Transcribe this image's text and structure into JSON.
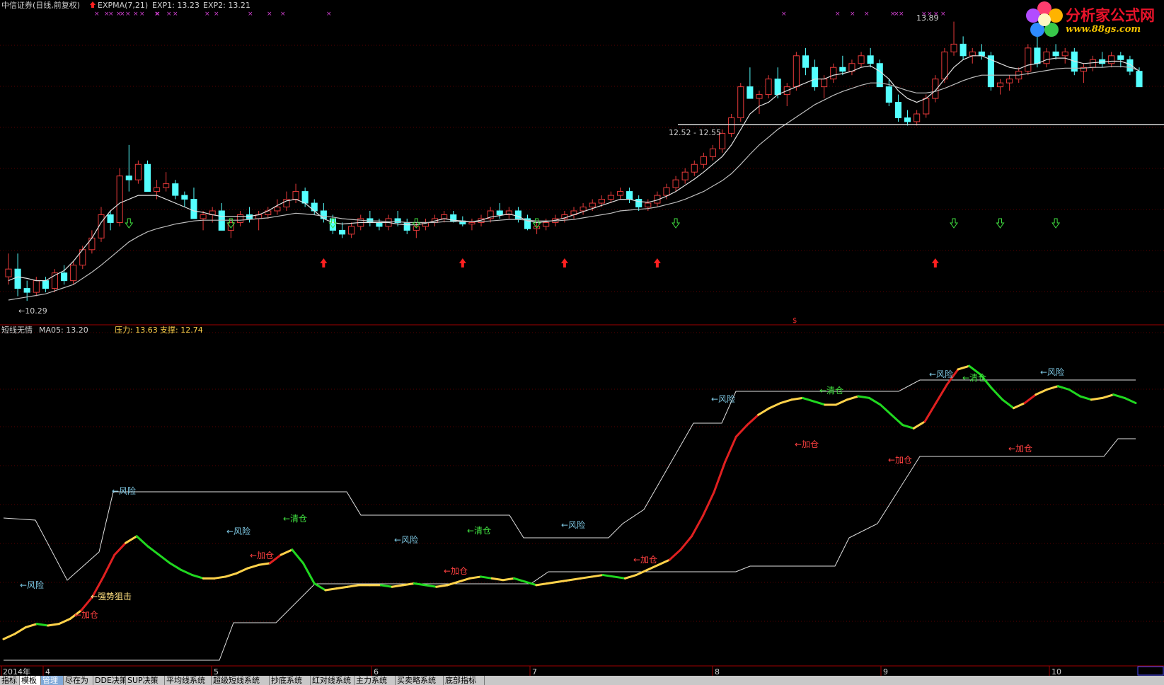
{
  "header": {
    "stock_title": "中信证券(日线,前复权)",
    "indicator_name": "EXPMA(7,21)",
    "exp1": "EXP1: 13.23",
    "exp2": "EXP2: 13.21"
  },
  "price_panel": {
    "high_label": "13.89",
    "low_label": "←10.29",
    "range_label": "12.52 - 12.55",
    "dollar_marker": "$"
  },
  "indicator_panel": {
    "name": "短线无情",
    "ma5": "MA05: 13.20",
    "pressure": "压力: 13.63",
    "support": "支撑: 12.74",
    "annotations": [
      {
        "text": "←风险",
        "color": "#7ec8e3"
      },
      {
        "text": "←加仓",
        "color": "#ff4040"
      },
      {
        "text": "←强势狙击",
        "color": "#ffe080"
      },
      {
        "text": "←风险",
        "color": "#7ec8e3"
      },
      {
        "text": "←风险",
        "color": "#7ec8e3"
      },
      {
        "text": "←加仓",
        "color": "#ff4040"
      },
      {
        "text": "←清仓",
        "color": "#40e040"
      },
      {
        "text": "←风险",
        "color": "#7ec8e3"
      },
      {
        "text": "←加仓",
        "color": "#ff4040"
      },
      {
        "text": "←清仓",
        "color": "#40e040"
      },
      {
        "text": "←风险",
        "color": "#7ec8e3"
      },
      {
        "text": "←加仓",
        "color": "#ff4040"
      },
      {
        "text": "←风险",
        "color": "#7ec8e3"
      },
      {
        "text": "←加仓",
        "color": "#ff4040"
      },
      {
        "text": "←清仓",
        "color": "#40e040"
      },
      {
        "text": "←加仓",
        "color": "#ff4040"
      },
      {
        "text": "←风险",
        "color": "#7ec8e3"
      },
      {
        "text": "←清仓",
        "color": "#40e040"
      },
      {
        "text": "←加仓",
        "color": "#ff4040"
      },
      {
        "text": "←风险",
        "color": "#7ec8e3"
      }
    ]
  },
  "time_axis": [
    "2014年",
    "4",
    "5",
    "6",
    "7",
    "8",
    "9",
    "10"
  ],
  "tabs": [
    "指标",
    "模板",
    "管理",
    "尽在为",
    "DDE决策",
    "SUP决策",
    "平均线系统",
    "超级短线系统",
    "抄底系统",
    "红对线系统",
    "主力系统",
    "买卖略系统",
    "底部指标"
  ],
  "logo": {
    "name": "分析家公式网",
    "url": "www.88gs.com"
  },
  "colors": {
    "up_candle": "#e83a3a",
    "down_candle": "#54ffff",
    "grid": "#5a0000",
    "seg_red": "#e02020",
    "seg_yellow": "#ffd24a",
    "seg_green": "#20d820"
  },
  "chart_data": [
    {
      "type": "candlestick",
      "title": "",
      "ylim": [
        10.2,
        13.95
      ],
      "ohlc": [
        [
          10.6,
          10.9,
          10.5,
          10.7
        ],
        [
          10.7,
          10.9,
          10.35,
          10.45
        ],
        [
          10.45,
          10.55,
          10.29,
          10.4
        ],
        [
          10.4,
          10.6,
          10.35,
          10.55
        ],
        [
          10.55,
          10.6,
          10.4,
          10.45
        ],
        [
          10.45,
          10.7,
          10.4,
          10.65
        ],
        [
          10.65,
          10.75,
          10.5,
          10.55
        ],
        [
          10.55,
          10.8,
          10.5,
          10.75
        ],
        [
          10.75,
          11.0,
          10.7,
          10.95
        ],
        [
          10.95,
          11.2,
          10.9,
          11.1
        ],
        [
          11.1,
          11.5,
          11.05,
          11.4
        ],
        [
          11.4,
          11.45,
          11.2,
          11.3
        ],
        [
          11.3,
          12.0,
          11.25,
          11.9
        ],
        [
          11.9,
          12.3,
          11.7,
          11.85
        ],
        [
          11.85,
          12.1,
          11.8,
          12.05
        ],
        [
          12.05,
          12.1,
          11.8,
          11.7
        ],
        [
          11.7,
          11.85,
          11.6,
          11.75
        ],
        [
          11.75,
          11.95,
          11.7,
          11.8
        ],
        [
          11.8,
          11.85,
          11.6,
          11.65
        ],
        [
          11.65,
          11.7,
          11.5,
          11.6
        ],
        [
          11.6,
          11.75,
          11.45,
          11.35
        ],
        [
          11.35,
          11.45,
          11.2,
          11.4
        ],
        [
          11.4,
          11.5,
          11.3,
          11.45
        ],
        [
          11.45,
          11.55,
          11.2,
          11.2
        ],
        [
          11.2,
          11.35,
          11.1,
          11.3
        ],
        [
          11.3,
          11.45,
          11.25,
          11.4
        ],
        [
          11.4,
          11.5,
          11.3,
          11.35
        ],
        [
          11.35,
          11.45,
          11.2,
          11.4
        ],
        [
          11.4,
          11.5,
          11.35,
          11.45
        ],
        [
          11.45,
          11.6,
          11.4,
          11.5
        ],
        [
          11.5,
          11.7,
          11.45,
          11.6
        ],
        [
          11.6,
          11.8,
          11.55,
          11.7
        ],
        [
          11.7,
          11.75,
          11.5,
          11.55
        ],
        [
          11.55,
          11.6,
          11.4,
          11.45
        ],
        [
          11.45,
          11.55,
          11.3,
          11.35
        ],
        [
          11.35,
          11.4,
          11.15,
          11.2
        ],
        [
          11.2,
          11.3,
          11.1,
          11.15
        ],
        [
          11.15,
          11.3,
          11.1,
          11.25
        ],
        [
          11.25,
          11.4,
          11.2,
          11.35
        ],
        [
          11.35,
          11.45,
          11.25,
          11.3
        ],
        [
          11.3,
          11.35,
          11.2,
          11.25
        ],
        [
          11.25,
          11.4,
          11.2,
          11.35
        ],
        [
          11.35,
          11.45,
          11.25,
          11.3
        ],
        [
          11.3,
          11.35,
          11.15,
          11.2
        ],
        [
          11.2,
          11.3,
          11.1,
          11.25
        ],
        [
          11.25,
          11.35,
          11.2,
          11.3
        ],
        [
          11.3,
          11.4,
          11.25,
          11.35
        ],
        [
          11.35,
          11.45,
          11.3,
          11.4
        ],
        [
          11.4,
          11.45,
          11.3,
          11.32
        ],
        [
          11.32,
          11.38,
          11.25,
          11.28
        ],
        [
          11.28,
          11.35,
          11.2,
          11.3
        ],
        [
          11.3,
          11.4,
          11.25,
          11.35
        ],
        [
          11.35,
          11.5,
          11.3,
          11.45
        ],
        [
          11.45,
          11.55,
          11.35,
          11.4
        ],
        [
          11.4,
          11.5,
          11.35,
          11.45
        ],
        [
          11.45,
          11.5,
          11.3,
          11.35
        ],
        [
          11.35,
          11.4,
          11.2,
          11.22
        ],
        [
          11.22,
          11.3,
          11.15,
          11.25
        ],
        [
          11.25,
          11.35,
          11.2,
          11.3
        ],
        [
          11.3,
          11.4,
          11.25,
          11.35
        ],
        [
          11.35,
          11.45,
          11.3,
          11.4
        ],
        [
          11.4,
          11.5,
          11.35,
          11.45
        ],
        [
          11.45,
          11.55,
          11.4,
          11.5
        ],
        [
          11.5,
          11.6,
          11.45,
          11.55
        ],
        [
          11.55,
          11.65,
          11.5,
          11.6
        ],
        [
          11.6,
          11.7,
          11.55,
          11.65
        ],
        [
          11.65,
          11.75,
          11.6,
          11.7
        ],
        [
          11.7,
          11.75,
          11.55,
          11.6
        ],
        [
          11.6,
          11.65,
          11.45,
          11.5
        ],
        [
          11.5,
          11.6,
          11.45,
          11.55
        ],
        [
          11.55,
          11.7,
          11.5,
          11.65
        ],
        [
          11.65,
          11.8,
          11.6,
          11.75
        ],
        [
          11.75,
          11.9,
          11.7,
          11.85
        ],
        [
          11.85,
          12.0,
          11.8,
          11.95
        ],
        [
          11.95,
          12.1,
          11.9,
          12.05
        ],
        [
          12.05,
          12.2,
          12.0,
          12.15
        ],
        [
          12.15,
          12.3,
          12.1,
          12.25
        ],
        [
          12.25,
          12.5,
          12.2,
          12.45
        ],
        [
          12.45,
          12.7,
          12.4,
          12.65
        ],
        [
          12.65,
          13.1,
          12.6,
          13.05
        ],
        [
          13.05,
          13.3,
          13.0,
          12.9
        ],
        [
          12.9,
          13.0,
          12.7,
          12.95
        ],
        [
          12.95,
          13.2,
          12.9,
          13.15
        ],
        [
          13.15,
          13.3,
          12.9,
          12.95
        ],
        [
          12.95,
          13.1,
          12.8,
          13.05
        ],
        [
          13.05,
          13.5,
          13.0,
          13.45
        ],
        [
          13.45,
          13.55,
          13.2,
          13.3
        ],
        [
          13.3,
          13.4,
          13.0,
          13.05
        ],
        [
          13.05,
          13.2,
          12.9,
          13.15
        ],
        [
          13.15,
          13.35,
          13.1,
          13.3
        ],
        [
          13.3,
          13.45,
          13.2,
          13.25
        ],
        [
          13.25,
          13.4,
          13.2,
          13.35
        ],
        [
          13.35,
          13.5,
          13.3,
          13.45
        ],
        [
          13.45,
          13.55,
          13.3,
          13.35
        ],
        [
          13.35,
          13.4,
          13.1,
          13.05
        ],
        [
          13.05,
          13.15,
          12.8,
          12.85
        ],
        [
          12.85,
          12.95,
          12.6,
          12.65
        ],
        [
          12.65,
          12.75,
          12.55,
          12.6
        ],
        [
          12.6,
          12.75,
          12.55,
          12.7
        ],
        [
          12.7,
          12.95,
          12.65,
          12.9
        ],
        [
          12.9,
          13.2,
          12.85,
          13.15
        ],
        [
          13.15,
          13.55,
          13.1,
          13.5
        ],
        [
          13.5,
          13.89,
          13.45,
          13.6
        ],
        [
          13.6,
          13.7,
          13.4,
          13.45
        ],
        [
          13.45,
          13.55,
          13.35,
          13.5
        ],
        [
          13.5,
          13.6,
          13.4,
          13.45
        ],
        [
          13.45,
          13.5,
          13.0,
          13.05
        ],
        [
          13.05,
          13.15,
          12.95,
          13.1
        ],
        [
          13.1,
          13.2,
          13.0,
          13.15
        ],
        [
          13.15,
          13.3,
          13.1,
          13.25
        ],
        [
          13.25,
          13.6,
          13.2,
          13.55
        ],
        [
          13.55,
          13.7,
          13.3,
          13.35
        ],
        [
          13.35,
          13.55,
          13.3,
          13.5
        ],
        [
          13.5,
          13.6,
          13.4,
          13.45
        ],
        [
          13.45,
          13.55,
          13.35,
          13.5
        ],
        [
          13.5,
          13.55,
          13.2,
          13.25
        ],
        [
          13.25,
          13.35,
          13.1,
          13.3
        ],
        [
          13.3,
          13.45,
          13.25,
          13.4
        ],
        [
          13.4,
          13.5,
          13.3,
          13.35
        ],
        [
          13.35,
          13.5,
          13.3,
          13.45
        ],
        [
          13.45,
          13.5,
          13.3,
          13.4
        ],
        [
          13.4,
          13.45,
          13.2,
          13.25
        ],
        [
          13.25,
          13.3,
          13.05,
          13.05
        ]
      ],
      "expma_fast": [
        10.55,
        10.6,
        10.58,
        10.55,
        10.55,
        10.62,
        10.68,
        10.8,
        10.95,
        11.1,
        11.3,
        11.45,
        11.55,
        11.6,
        11.65,
        11.65,
        11.65,
        11.6,
        11.55,
        11.5,
        11.45,
        11.43,
        11.4,
        11.38,
        11.38,
        11.38,
        11.38,
        11.4,
        11.45,
        11.52,
        11.58,
        11.6,
        11.55,
        11.45,
        11.35,
        11.3,
        11.28,
        11.29,
        11.3,
        11.3,
        11.3,
        11.3,
        11.28,
        11.27,
        11.27,
        11.29,
        11.32,
        11.35,
        11.33,
        11.32,
        11.31,
        11.33,
        11.37,
        11.39,
        11.41,
        11.38,
        11.32,
        11.3,
        11.31,
        11.33,
        11.36,
        11.4,
        11.44,
        11.48,
        11.52,
        11.56,
        11.6,
        11.6,
        11.57,
        11.56,
        11.59,
        11.64,
        11.7,
        11.78,
        11.86,
        11.95,
        12.05,
        12.15,
        12.3,
        12.5,
        12.7,
        12.8,
        12.85,
        12.95,
        13.0,
        13.05,
        13.1,
        13.15,
        13.15,
        13.2,
        13.22,
        13.25,
        13.3,
        13.32,
        13.25,
        13.15,
        13.0,
        12.9,
        12.85,
        12.9,
        13.0,
        13.15,
        13.3,
        13.4,
        13.45,
        13.45,
        13.4,
        13.35,
        13.3,
        13.28,
        13.33,
        13.35,
        13.4,
        13.42,
        13.42,
        13.38,
        13.35,
        13.36,
        13.37,
        13.38,
        13.38,
        13.34,
        13.25
      ],
      "expma_slow": [
        10.3,
        10.32,
        10.34,
        10.36,
        10.38,
        10.42,
        10.46,
        10.5,
        10.58,
        10.66,
        10.75,
        10.85,
        10.95,
        11.05,
        11.12,
        11.18,
        11.22,
        11.25,
        11.28,
        11.3,
        11.32,
        11.33,
        11.33,
        11.33,
        11.33,
        11.33,
        11.34,
        11.35,
        11.36,
        11.38,
        11.4,
        11.42,
        11.41,
        11.4,
        11.38,
        11.37,
        11.35,
        11.34,
        11.33,
        11.32,
        11.32,
        11.31,
        11.31,
        11.3,
        11.3,
        11.3,
        11.3,
        11.31,
        11.31,
        11.31,
        11.31,
        11.31,
        11.32,
        11.33,
        11.34,
        11.34,
        11.33,
        11.32,
        11.32,
        11.32,
        11.33,
        11.34,
        11.36,
        11.38,
        11.4,
        11.42,
        11.45,
        11.46,
        11.47,
        11.48,
        11.5,
        11.53,
        11.56,
        11.6,
        11.65,
        11.7,
        11.77,
        11.84,
        11.93,
        12.05,
        12.18,
        12.3,
        12.4,
        12.5,
        12.58,
        12.66,
        12.74,
        12.82,
        12.88,
        12.94,
        12.99,
        13.03,
        13.07,
        13.1,
        13.1,
        13.08,
        13.04,
        13.0,
        12.97,
        12.97,
        12.99,
        13.03,
        13.08,
        13.13,
        13.17,
        13.2,
        13.2,
        13.2,
        13.2,
        13.2,
        13.22,
        13.24,
        13.26,
        13.28,
        13.29,
        13.29,
        13.29,
        13.3,
        13.3,
        13.31,
        13.31,
        13.3,
        13.26
      ]
    },
    {
      "type": "line",
      "title": "",
      "series": [
        {
          "values": [
            0.05,
            0.08,
            0.12,
            0.14,
            0.13,
            0.14,
            0.17,
            0.22,
            0.3,
            0.42,
            0.55,
            0.62,
            0.66,
            0.6,
            0.55,
            0.5,
            0.46,
            0.43,
            0.41,
            0.41,
            0.42,
            0.44,
            0.47,
            0.49,
            0.5,
            0.55,
            0.58,
            0.5,
            0.38,
            0.34,
            0.35,
            0.36,
            0.37,
            0.37,
            0.37,
            0.36,
            0.37,
            0.38,
            0.37,
            0.36,
            0.37,
            0.39,
            0.41,
            0.42,
            0.41,
            0.4,
            0.41,
            0.39,
            0.37,
            0.38,
            0.39,
            0.4,
            0.41,
            0.42,
            0.43,
            0.42,
            0.41,
            0.43,
            0.46,
            0.49,
            0.52,
            0.58,
            0.66,
            0.78,
            0.92,
            1.1,
            1.25,
            1.32,
            1.38,
            1.42,
            1.45,
            1.47,
            1.48,
            1.46,
            1.44,
            1.44,
            1.47,
            1.49,
            1.48,
            1.44,
            1.38,
            1.32,
            1.3,
            1.34,
            1.45,
            1.56,
            1.65,
            1.67,
            1.62,
            1.54,
            1.47,
            1.42,
            1.45,
            1.5,
            1.53,
            1.55,
            1.53,
            1.49,
            1.47,
            1.48,
            1.5,
            1.48,
            1.45
          ]
        }
      ]
    }
  ]
}
